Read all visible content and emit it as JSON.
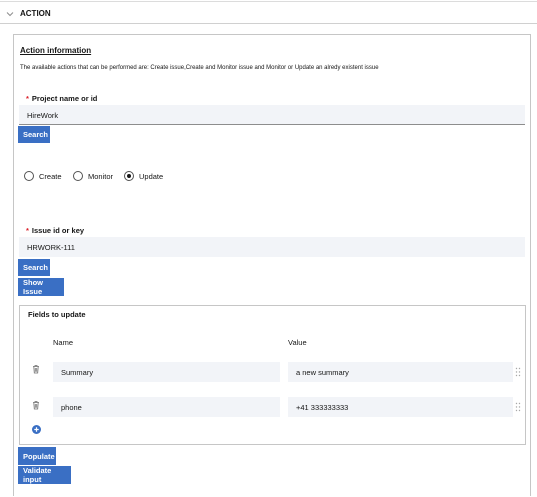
{
  "accordion": {
    "title": "ACTION"
  },
  "section": {
    "title": "Action information",
    "description": "The available actions that can be performed are: Create issue,Create and Monitor issue and Monitor or Update an alredy existent issue"
  },
  "project": {
    "required_mark": "*",
    "label": "Project name or id",
    "value": "HireWork",
    "search_label": "Search"
  },
  "action_options": [
    {
      "label": "Create",
      "selected": false
    },
    {
      "label": "Monitor",
      "selected": false
    },
    {
      "label": "Update",
      "selected": true
    }
  ],
  "issue": {
    "required_mark": "*",
    "label": "Issue id or key",
    "value": "HRWORK-111",
    "search_label": "Search",
    "show_label": "Show Issue"
  },
  "fields_to_update": {
    "title": "Fields to update",
    "col_name": "Name",
    "col_value": "Value",
    "rows": [
      {
        "name": "Summary",
        "value": "a new summary"
      },
      {
        "name": "phone",
        "value": "+41 333333333"
      }
    ]
  },
  "buttons": {
    "populate": "Populate",
    "validate": "Validate input"
  },
  "colors": {
    "primary": "#3a6fc4",
    "field_bg": "#f2f4f8",
    "required": "#da1e28"
  }
}
